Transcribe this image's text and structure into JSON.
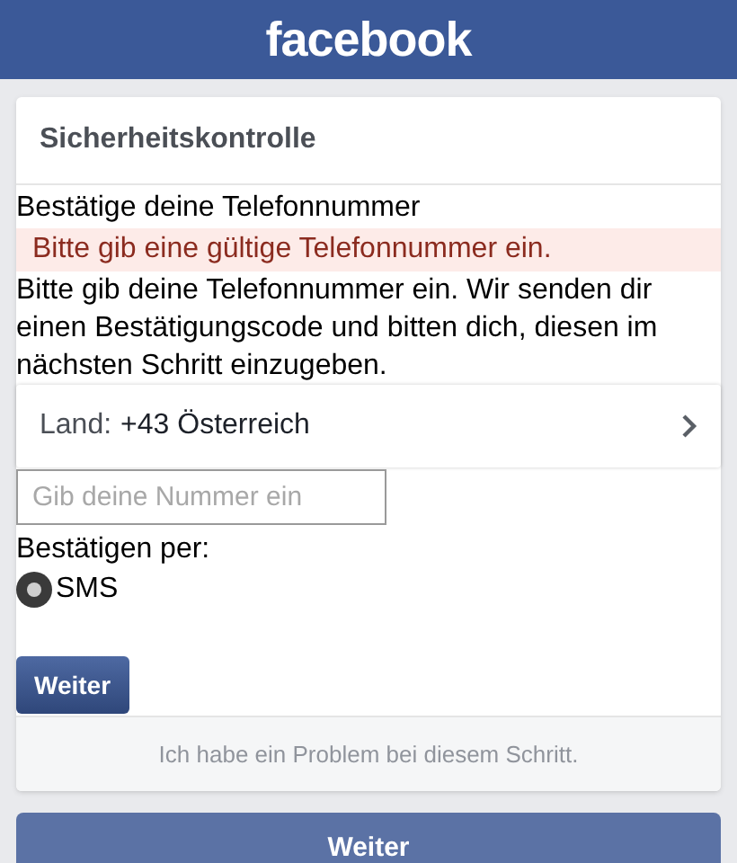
{
  "header": {
    "logo": "facebook"
  },
  "card": {
    "title": "Sicherheitskontrolle",
    "heading": "Bestätige deine Telefonnummer",
    "error": "Bitte gib eine gültige Telefonnummer ein.",
    "description": "Bitte gib deine Telefonnummer ein. Wir senden dir einen Bestätigungscode und bitten dich, diesen im nächsten Schritt einzugeben.",
    "country": {
      "label": "Land:",
      "value": "+43 Österreich"
    },
    "phone_field": {
      "placeholder": "Gib deine Nummer ein"
    },
    "confirm_label": "Bestätigen per:",
    "options": [
      {
        "label": "SMS",
        "selected": true
      }
    ],
    "submit": "Weiter",
    "problem_link": "Ich habe ein Problem bei diesem Schritt."
  },
  "footer_button": "Weiter"
}
